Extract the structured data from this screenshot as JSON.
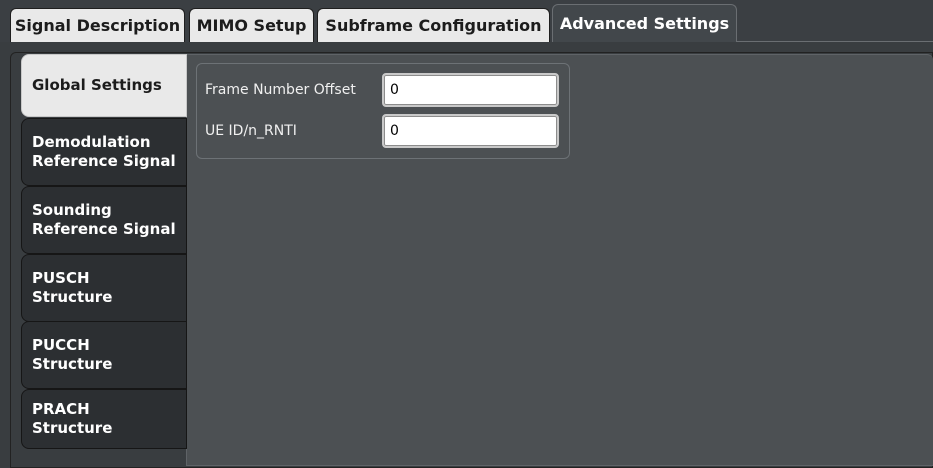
{
  "top_tabs": [
    {
      "label": "Signal Description",
      "active": false
    },
    {
      "label": "MIMO Setup",
      "active": false
    },
    {
      "label": "Subframe Configuration",
      "active": false
    },
    {
      "label": "Advanced Settings",
      "active": true
    }
  ],
  "side_tabs": [
    {
      "label_lines": [
        "Global Settings"
      ],
      "active": true
    },
    {
      "label_lines": [
        "Demodulation",
        "Reference Signal"
      ],
      "active": false
    },
    {
      "label_lines": [
        "Sounding",
        "Reference Signal"
      ],
      "active": false
    },
    {
      "label_lines": [
        "PUSCH",
        "Structure"
      ],
      "active": false
    },
    {
      "label_lines": [
        "PUCCH",
        "Structure"
      ],
      "active": false
    },
    {
      "label_lines": [
        "PRACH",
        "Structure"
      ],
      "active": false
    }
  ],
  "global_settings": {
    "frame_number_offset": {
      "label": "Frame Number Offset",
      "value": "0"
    },
    "ue_id": {
      "label": "UE ID/n_RNTI",
      "value": "0"
    }
  },
  "colors": {
    "background": "#3b3f43",
    "panel": "#4c5053",
    "tab_inactive": "#e9e9e9",
    "side_tab_dark": "#2c2f32"
  }
}
